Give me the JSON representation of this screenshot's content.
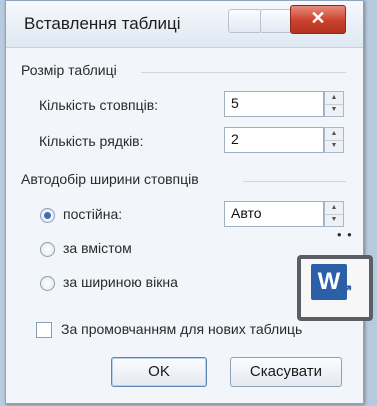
{
  "window": {
    "title": "Вставлення таблиці",
    "close_glyph": "✕"
  },
  "table_size": {
    "heading": "Розмір таблиці",
    "columns_label": "Кількість стовпців:",
    "columns_value": "5",
    "rows_label": "Кількість рядків:",
    "rows_value": "2"
  },
  "autofit": {
    "heading": "Автодобір ширини стовпців",
    "fixed_label": "постійна:",
    "fixed_value": "Авто",
    "content_label": "за вмістом",
    "window_label": "за шириною вікна",
    "selected": "fixed"
  },
  "remember": {
    "label": "За промовчанням для нових таблиць",
    "checked": false
  },
  "buttons": {
    "ok": "OK",
    "cancel": "Скасувати"
  },
  "badge": {
    "letter": "W",
    "dots": "• •"
  },
  "colors": {
    "accent": "#3a6fb5",
    "close": "#c9412c",
    "word": "#2b5fa8"
  }
}
